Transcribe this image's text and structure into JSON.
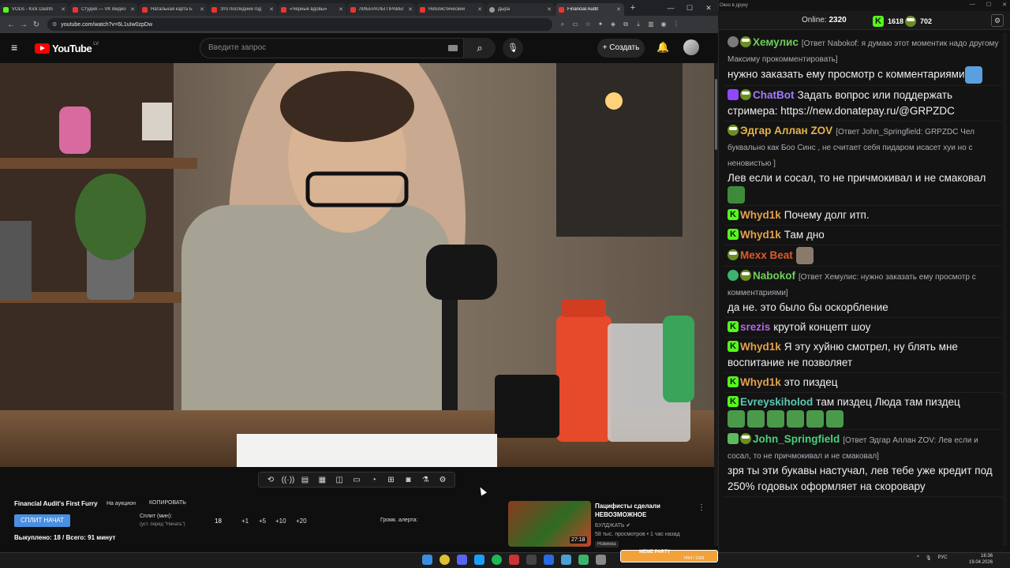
{
  "browser": {
    "tabs": [
      {
        "label": "VODs - Kick Dashb",
        "icon": "kick-icon"
      },
      {
        "label": "Студия — VK Видео",
        "icon": "vk-icon"
      },
      {
        "label": "Натальная карта Б",
        "icon": "youtube-icon"
      },
      {
        "label": "Это последний год",
        "icon": "youtube-icon"
      },
      {
        "label": "«Черные вдовы»",
        "icon": "youtube-icon"
      },
      {
        "label": "ЛИБЕРАЛЫ ПРАВЫ",
        "icon": "youtube-icon"
      },
      {
        "label": "Неturистический",
        "icon": "youtube-icon"
      },
      {
        "label": "Дыра",
        "icon": "generic-icon"
      },
      {
        "label": "Financial Audit",
        "icon": "youtube-icon",
        "active": true
      }
    ],
    "url": "youtube.com/watch?v=6L1uIw0zpDw"
  },
  "youtube": {
    "logo_text": "YouTube",
    "country": "LV",
    "search_placeholder": "Введите запрос",
    "create_label": "Создать"
  },
  "player_tools": [
    "loop-icon",
    "audio-icon",
    "stats-icon",
    "clip-icon",
    "pip-icon",
    "cinema-icon",
    "speed-icon",
    "screenshot-add-icon",
    "camera-icon",
    "lab-icon",
    "gear-icon"
  ],
  "auction": {
    "title": "Financial Audit's First Furry",
    "status": "На аукцион",
    "copy": "КОПИРОВАТЬ",
    "split_button": "СПЛИТ НАЧАТ",
    "split_label": "Сплит (мин):",
    "split_hint": "(уст. перед \"Начать\")",
    "split_value": "18",
    "increments": [
      "+1",
      "+5",
      "+10",
      "+20"
    ],
    "alert_volume": "Громк. алерта:",
    "sold": "Выкуплено: 18 / Всего: 91 минут"
  },
  "recommendation": {
    "title": "Пацифисты сделали НЕВОЗМОЖНОЕ",
    "channel": "БУЛДЖАТЬ",
    "meta": "58 тыс. просмотров • 1 час назад",
    "badge": "Новинка",
    "duration": "27:18"
  },
  "chat": {
    "window_title": "Окно в друку",
    "online_label": "Online:",
    "online_value": "2320",
    "kick_count": "1618",
    "other_count": "702",
    "messages": [
      {
        "user": "Хемулис",
        "color": "#6fcf5a",
        "badges": [
          "shield",
          "pepe"
        ],
        "reply": "[Ответ Nabokof: я думаю этот моментик надо другому Максиму прокомментировать]",
        "text": "нужно заказать ему просмотр с комментариями",
        "emote": true
      },
      {
        "user": "ChatBot",
        "color": "#a37bff",
        "badges": [
          "bot",
          "pepe"
        ],
        "reply": "",
        "text": "Задать вопрос или поддержать стримера: https://new.donatepay.ru/@GRPZDC"
      },
      {
        "user": "Эдгар Аллан ZOV",
        "color": "#e6b34a",
        "badges": [
          "pepe"
        ],
        "reply": "[Ответ John_Springfield: GRPZDC Чел буквально как Боо Синс , не считает себя пидаром исасет хуи но с неновистью ]",
        "text": "Лев если и сосал, то не причмокивал и не смаковал",
        "emote": true
      },
      {
        "user": "Whyd1k",
        "color": "#e6a04a",
        "badges": [
          "kick"
        ],
        "reply": "",
        "text": "Почему долг итп."
      },
      {
        "user": "Whyd1k",
        "color": "#e6a04a",
        "badges": [
          "kick"
        ],
        "reply": "",
        "text": "Там дно"
      },
      {
        "user": "Mexx Beat",
        "color": "#e05a2a",
        "badges": [
          "pepe"
        ],
        "reply": "",
        "text": "",
        "emote": true
      },
      {
        "user": "Nabokof",
        "color": "#6fcf5a",
        "badges": [
          "green",
          "pepe"
        ],
        "reply": "[Ответ Хемулис: нужно заказать ему просмотр с комментариями]",
        "text": "да не. это было бы оскорбление"
      },
      {
        "user": "srezis",
        "color": "#b06ae0",
        "badges": [
          "kick"
        ],
        "reply": "",
        "text": "крутой концепт шоу"
      },
      {
        "user": "Whyd1k",
        "color": "#e6a04a",
        "badges": [
          "kick"
        ],
        "reply": "",
        "text": "Я эту хуйню смотрел, ну блять мне воспитание не позволяет"
      },
      {
        "user": "Whyd1k",
        "color": "#e6a04a",
        "badges": [
          "kick"
        ],
        "reply": "",
        "text": "это пиздец"
      },
      {
        "user": "Evreyskiholod",
        "color": "#5ac8b4",
        "badges": [
          "kick"
        ],
        "reply": "",
        "text": "там пиздец Люда там пиздец",
        "emote_row": 6
      },
      {
        "user": "John_Springfield",
        "color": "#4ad07a",
        "badges": [
          "sword",
          "pepe"
        ],
        "reply": "[Ответ Эдгар Аллан ZOV: Лев если и сосал, то не причмокивал и не смаковал]",
        "text": "зря ты эти букавы настучал, лев тебе уже кредит под 250% годовых оформляет на скоровару"
      }
    ]
  },
  "taskbar": {
    "lang": "РУС",
    "time": "16:36",
    "date": "19.04.2026",
    "meme_widget": "MEME PARTY",
    "meme_count": "7454 / 1500"
  }
}
